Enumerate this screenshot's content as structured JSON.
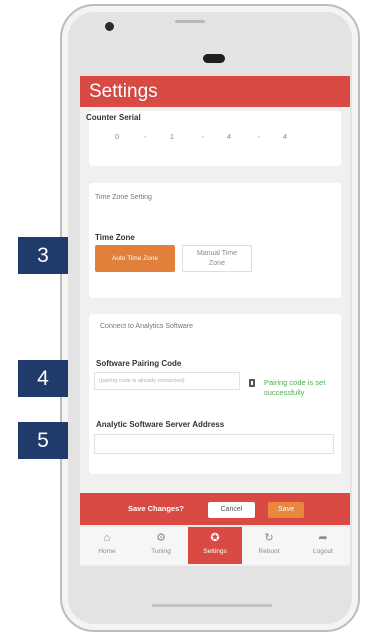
{
  "header": {
    "title": "Settings"
  },
  "counter": {
    "title": "Counter Serial",
    "segments": [
      "0",
      "1",
      "4",
      "4"
    ]
  },
  "timezone": {
    "section_title": "Time Zone Setting",
    "label": "Time Zone",
    "auto_button": "Auto Time Zone",
    "manual_button_line1": "Manual Time",
    "manual_button_line2": "Zone"
  },
  "analytics": {
    "section_title": "Connect to Analytics Software",
    "pairing_label": "Software Pairing Code",
    "pairing_placeholder": "(pairing code is already connected)",
    "pairing_success": "Pairing code is set successfully",
    "address_label": "Analytic Software Server Address",
    "address_value": ""
  },
  "save_bar": {
    "question": "Save Changes?",
    "cancel": "Cancel",
    "save": "Save"
  },
  "nav": {
    "items": [
      {
        "label": "Home",
        "icon": "home-icon",
        "glyph": "⌂"
      },
      {
        "label": "Tuning",
        "icon": "tuning-icon",
        "glyph": "⚙"
      },
      {
        "label": "Settings",
        "icon": "settings-icon",
        "glyph": "✪"
      },
      {
        "label": "Reboot",
        "icon": "reboot-icon",
        "glyph": "↻"
      },
      {
        "label": "Logout",
        "icon": "logout-icon",
        "glyph": "➦"
      }
    ],
    "active": "Settings"
  },
  "callouts": [
    "3",
    "4",
    "5"
  ],
  "colors": {
    "header_red": "#d94a45",
    "accent_orange": "#e0803a",
    "success_green": "#4caf50",
    "callout_navy": "#1f3a6b"
  }
}
